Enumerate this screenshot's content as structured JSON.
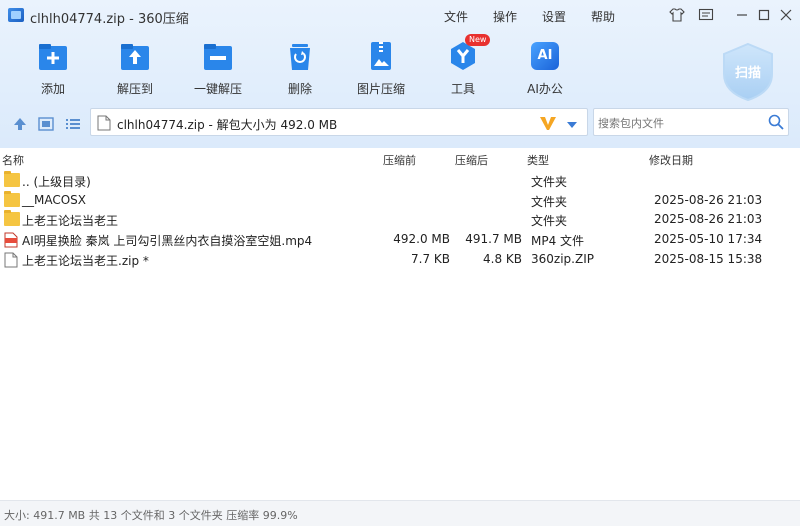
{
  "window": {
    "title": "clhlh04774.zip - 360压缩",
    "menu": [
      "文件",
      "操作",
      "设置",
      "帮助"
    ]
  },
  "toolbar": {
    "buttons": [
      {
        "label": "添加",
        "icon": "add-icon"
      },
      {
        "label": "解压到",
        "icon": "extract-to-icon"
      },
      {
        "label": "一键解压",
        "icon": "quick-extract-icon"
      },
      {
        "label": "删除",
        "icon": "delete-icon"
      },
      {
        "label": "图片压缩",
        "icon": "image-compress-icon"
      },
      {
        "label": "工具",
        "icon": "tools-icon",
        "badge": "New"
      },
      {
        "label": "AI办公",
        "icon": "ai-office-icon",
        "icon_text": "AI"
      }
    ],
    "scan_label": "扫描"
  },
  "address": {
    "text": "clhlh04774.zip - 解包大小为 492.0 MB"
  },
  "search": {
    "placeholder": "搜索包内文件"
  },
  "columns": {
    "name": "名称",
    "compressed_before": "压缩前",
    "compressed_after": "压缩后",
    "type": "类型",
    "modified": "修改日期"
  },
  "files": [
    {
      "name": ".. (上级目录)",
      "before": "",
      "after": "",
      "type": "文件夹",
      "date": "",
      "icon": "folder-up-icon"
    },
    {
      "name": "__MACOSX",
      "before": "",
      "after": "",
      "type": "文件夹",
      "date": "2025-08-26 21:03",
      "icon": "folder-icon"
    },
    {
      "name": "上老王论坛当老王",
      "before": "",
      "after": "",
      "type": "文件夹",
      "date": "2025-08-26 21:03",
      "icon": "folder-icon"
    },
    {
      "name": "AI明星换脸  秦岚  上司勾引黑丝内衣自摸浴室空姐.mp4",
      "before": "492.0 MB",
      "after": "491.7 MB",
      "type": "MP4 文件",
      "date": "2025-05-10 17:34",
      "icon": "mp4-file-icon"
    },
    {
      "name": "上老王论坛当老王.zip *",
      "before": "7.7 KB",
      "after": "4.8 KB",
      "type": "360zip.ZIP",
      "date": "2025-08-15 15:38",
      "icon": "zip-file-icon"
    }
  ],
  "status": {
    "text": "大小: 491.7 MB 共 13 个文件和 3 个文件夹 压缩率 99.9%"
  },
  "colors": {
    "accent": "#1e7be6",
    "toolbar_bg": "#e3eefb",
    "folder": "#f5c542"
  }
}
